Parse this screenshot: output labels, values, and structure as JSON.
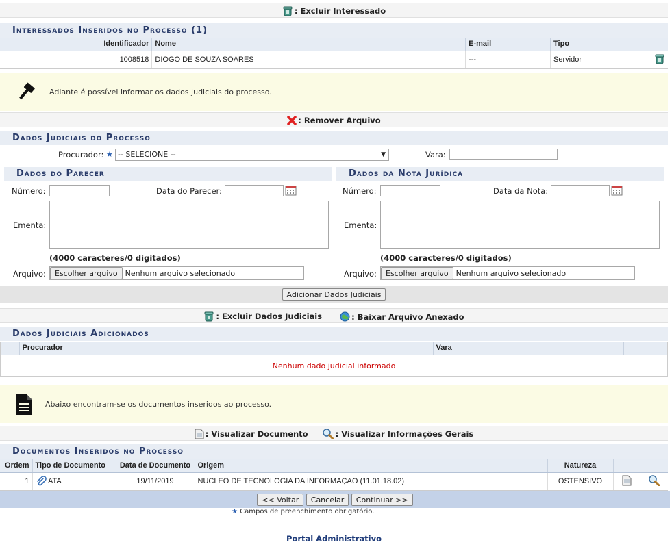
{
  "top_legend": {
    "delete_label": ": Excluir Interessado"
  },
  "interessados": {
    "title": "Interessados Inseridos no Processo (1)",
    "columns": [
      "Identificador",
      "Nome",
      "E-mail",
      "Tipo"
    ],
    "rows": [
      {
        "identificador": "1008518",
        "nome": "DIOGO DE SOUZA SOARES",
        "email": "---",
        "tipo": "Servidor"
      }
    ]
  },
  "notice_judicial": {
    "text": "Adiante é possível informar os dados judiciais do processo."
  },
  "remove_legend": {
    "label": ": Remover Arquivo"
  },
  "dados_judiciais": {
    "title": "Dados Judiciais do Processo",
    "procurador_label": "Procurador:",
    "procurador_value": "-- SELECIONE --",
    "vara_label": "Vara:",
    "vara_value": ""
  },
  "parecer": {
    "title": "Dados do Parecer",
    "numero_label": "Número:",
    "data_label": "Data do Parecer:",
    "ementa_label": "Ementa:",
    "counter": "(4000 caracteres/0 digitados)",
    "arquivo_label": "Arquivo:",
    "file_button": "Escolher arquivo",
    "file_status": "Nenhum arquivo selecionado"
  },
  "nota": {
    "title": "Dados da Nota Jurídica",
    "numero_label": "Número:",
    "data_label": "Data da Nota:",
    "ementa_label": "Ementa:",
    "counter": "(4000 caracteres/0 digitados)",
    "arquivo_label": "Arquivo:",
    "file_button": "Escolher arquivo",
    "file_status": "Nenhum arquivo selecionado"
  },
  "add_button": "Adicionar Dados Judiciais",
  "mid_legend": {
    "delete_label": ": Excluir Dados Judiciais",
    "download_label": ": Baixar Arquivo Anexado"
  },
  "adicionados": {
    "title": "Dados Judiciais Adicionados",
    "columns": [
      "Procurador",
      "Vara"
    ],
    "empty_message": "Nenhum dado judicial informado"
  },
  "notice_docs": {
    "text": "Abaixo encontram-se os documentos inseridos ao processo."
  },
  "doc_legend": {
    "view_label": ": Visualizar Documento",
    "info_label": ": Visualizar Informações Gerais"
  },
  "documentos": {
    "title": "Documentos Inseridos no Processo",
    "columns": [
      "Ordem",
      "Tipo de Documento",
      "Data de Documento",
      "Origem",
      "Natureza"
    ],
    "rows": [
      {
        "ordem": "1",
        "tipo": "ATA",
        "data": "19/11/2019",
        "origem": "NUCLEO DE TECNOLOGIA DA INFORMAÇAO (11.01.18.02)",
        "natureza": "OSTENSIVO"
      }
    ]
  },
  "nav": {
    "back": "<< Voltar",
    "cancel": "Cancelar",
    "continue": "Continuar >>"
  },
  "required_note": "Campos de preenchimento obrigatório.",
  "footer": {
    "portal": "Portal Administrativo"
  },
  "colors": {
    "section_title": "#2a3c6a",
    "error_red": "#cc0000",
    "notice_bg": "#fbfbe4",
    "nav_bar": "#c4d2e8"
  }
}
